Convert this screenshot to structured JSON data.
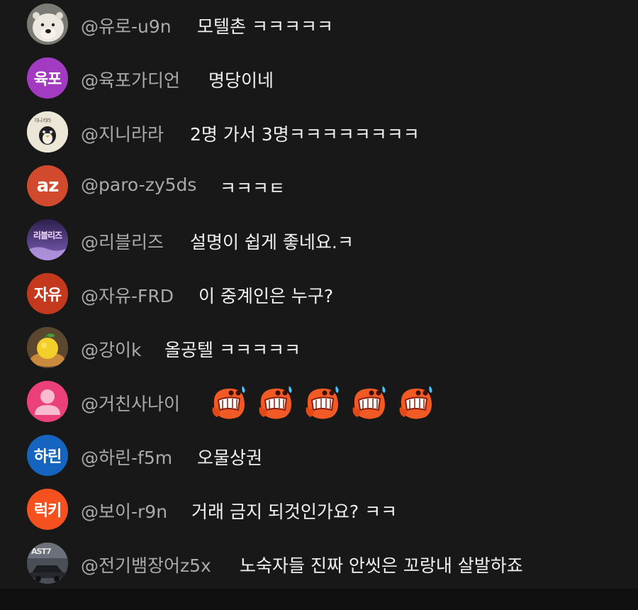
{
  "chat": {
    "messages": [
      {
        "author": "@유로-u9n",
        "text": "모텔촌 ㅋㅋㅋㅋㅋ",
        "avatar": {
          "type": "photo",
          "icon": "polar-bear-photo"
        }
      },
      {
        "author": "@육포가디언",
        "text": "명당이네",
        "avatar": {
          "type": "letter",
          "label": "육포",
          "color": "#a23bc2"
        }
      },
      {
        "author": "@지니라라",
        "text": "2명 가서 3명ㅋㅋㅋㅋㅋㅋㅋㅋ",
        "avatar": {
          "type": "photo",
          "icon": "penguin-sketch-photo"
        }
      },
      {
        "author": "@paro-zy5ds",
        "text": "ㅋㅋㅋㅌ",
        "avatar": {
          "type": "letter",
          "label": "az",
          "color": "#d24a2d"
        }
      },
      {
        "author": "@리블리즈",
        "text": "설명이 쉽게 좋네요.ㅋ",
        "avatar": {
          "type": "photo",
          "label": "리블리즈",
          "icon": "purple-logo-photo"
        }
      },
      {
        "author": "@자유-FRD",
        "text": "이 중계인은 누구?",
        "avatar": {
          "type": "letter",
          "label": "자유",
          "color": "#c4391e"
        }
      },
      {
        "author": "@강이k",
        "text": "올공텔 ㅋㅋㅋㅋㅋ",
        "avatar": {
          "type": "photo",
          "icon": "lemon-dessert-photo"
        }
      },
      {
        "author": "@거친사나이",
        "text": "",
        "avatar": {
          "type": "default",
          "color": "#ec407a",
          "icon": "person-icon"
        },
        "emojis": [
          "sweating-face-emoji",
          "sweating-face-emoji",
          "sweating-face-emoji",
          "sweating-face-emoji",
          "sweating-face-emoji"
        ]
      },
      {
        "author": "@하린-f5m",
        "text": "오물상권",
        "avatar": {
          "type": "letter",
          "label": "하린",
          "color": "#1565c0"
        }
      },
      {
        "author": "@보이-r9n",
        "text": "거래 금지 되것인가요? ㅋㅋ",
        "avatar": {
          "type": "letter",
          "label": "럭키",
          "color": "#f4511e"
        }
      },
      {
        "author": "@전기뱀장어z5x",
        "text": "노숙자들 진짜 안씻은 꼬랑내 살발하죠",
        "avatar": {
          "type": "photo",
          "label": "AST7",
          "icon": "car-photo"
        }
      }
    ]
  },
  "colors": {
    "background": "#181818",
    "author": "#aaaaaa",
    "text": "#f1f1f1",
    "bottom_bar": "#0f0f0f"
  }
}
